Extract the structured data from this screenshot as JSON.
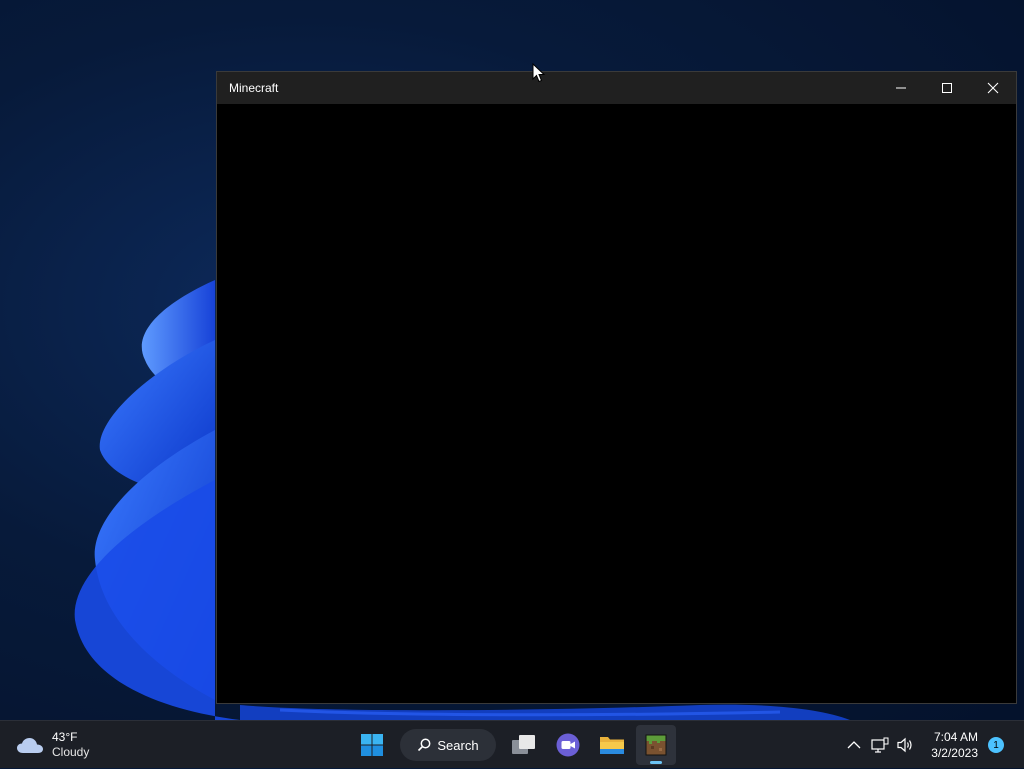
{
  "window": {
    "title": "Minecraft"
  },
  "taskbar": {
    "weather": {
      "temperature": "43°F",
      "condition": "Cloudy",
      "icon": "cloud-icon"
    },
    "search_label": "Search",
    "apps": [
      {
        "name": "start-button",
        "icon": "windows-logo-icon"
      },
      {
        "name": "task-view-button",
        "icon": "task-view-icon"
      },
      {
        "name": "teams-chat-button",
        "icon": "video-chat-icon"
      },
      {
        "name": "file-explorer-button",
        "icon": "folder-icon"
      },
      {
        "name": "minecraft-taskbar-button",
        "icon": "minecraft-grass-block-icon",
        "active": true
      }
    ],
    "clock": {
      "time": "7:04 AM",
      "date": "3/2/2023"
    },
    "notification_count": "1"
  },
  "colors": {
    "taskbar_bg": "#1c1f26",
    "titlebar_bg": "#202020",
    "accent": "#4cc2ff",
    "wallpaper_blue": "#1f55e0"
  }
}
